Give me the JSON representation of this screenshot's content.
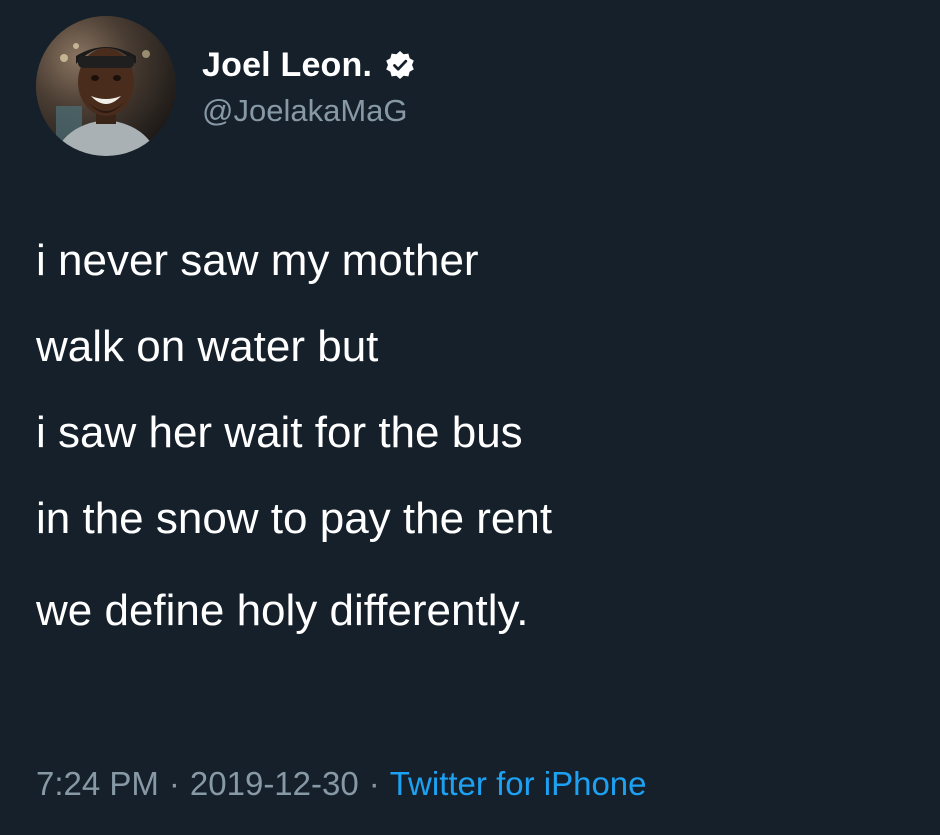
{
  "user": {
    "display_name": "Joel Leon.",
    "handle": "@JoelakaMaG",
    "verified_icon": "verified-badge-icon",
    "avatar_icon": "profile-photo"
  },
  "tweet": {
    "lines": [
      "i never saw my mother",
      "walk on water but",
      "i saw her wait for the bus",
      "in the snow to pay the rent",
      "we define holy differently."
    ]
  },
  "meta": {
    "time": "7:24 PM",
    "separator": "·",
    "date": "2019-12-30",
    "source": "Twitter for iPhone"
  },
  "colors": {
    "background": "#15202b",
    "text": "#ffffff",
    "secondary": "#8899a6",
    "link": "#1da1f2"
  }
}
